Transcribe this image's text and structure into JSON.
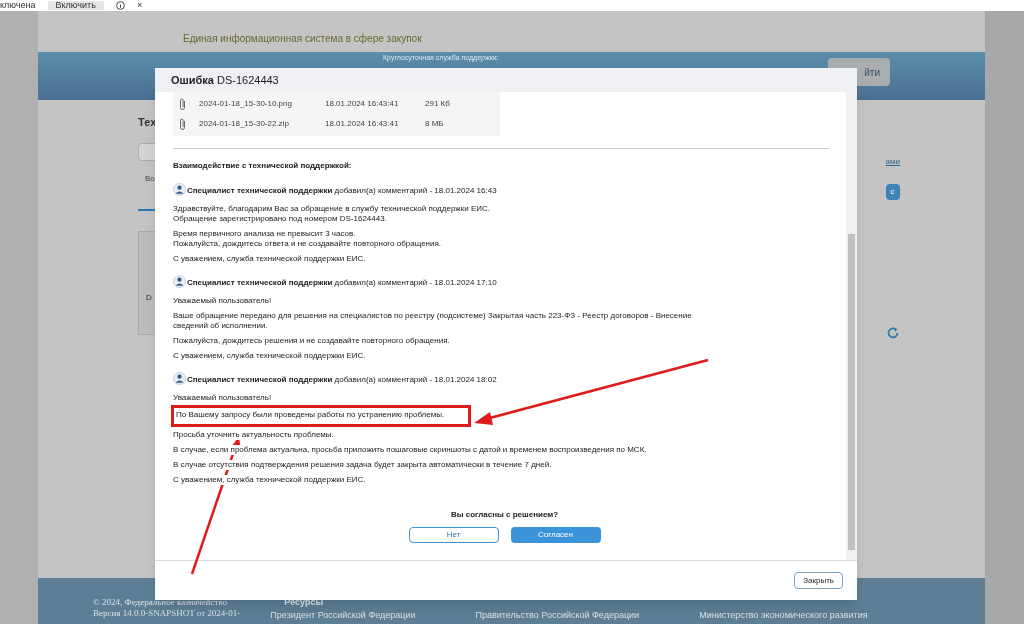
{
  "browser_bar": {
    "notice": "ключена",
    "button": "Включить",
    "close": "×"
  },
  "site": {
    "title": "Единая информационная система в сфере закупок",
    "support": "Круглосуточная служба поддержки:",
    "logout": "йти",
    "heading": "Тех",
    "field": "Во",
    "row_text": "D",
    "link": "ами",
    "action": "с"
  },
  "footer": {
    "copyright": "© 2024, Федеральное казначейство",
    "version": "Версия 14.0.0-SNAPSHOT от 2024-01-",
    "resources": "Ресурсы",
    "links": [
      "Президент Российской Федерации",
      "Правительство Российской Федерации",
      "Министерство экономического развития"
    ]
  },
  "modal": {
    "title": "**Ошибка** DS-1624443",
    "files": [
      {
        "name": "2024-01-18_15-30-10.png",
        "date": "18.01.2024 16:43:41",
        "size": "291 Кб"
      },
      {
        "name": "2024-01-18_15-30-22.zip",
        "date": "18.01.2024 16:43:41",
        "size": "8 МБ"
      }
    ],
    "section_heading": "Взаимодействие с технической поддержкой:",
    "comments": [
      {
        "header": "**Специалист технической поддержки** добавил(а) комментарий - 18.01.2024 16:43",
        "paragraphs": [
          {
            "text": "Здравствуйте, благодарим Вас за обращение в службу технической поддержки ЕИС.\nОбращение зарегистрировано под номером DS-1624443.",
            "highlighted": false
          },
          {
            "text": "Время первичного анализа не превысит 3 часов.\nПожалуйста, дождитесь ответа и не создавайте повторного обращения.",
            "highlighted": false
          },
          {
            "text": "С уважением, служба технической поддержки ЕИС.",
            "highlighted": false
          }
        ]
      },
      {
        "header": "**Специалист технической поддержки** добавил(а) комментарий - 18.01.2024 17:10",
        "paragraphs": [
          {
            "text": "Уважаемый пользователь!",
            "highlighted": false
          },
          {
            "text": "Ваше обращение передано для решения на специалистов по реестру (подсистеме) Закрытая часть 223-ФЗ - Реестр договоров - Внесение\nсведений об исполнении.",
            "highlighted": false
          },
          {
            "text": "Пожалуйста, дождитесь решения и не создавайте повторного обращения.",
            "highlighted": false
          },
          {
            "text": "С уважением, служба технической поддержки ЕИС.",
            "highlighted": false
          }
        ]
      },
      {
        "header": "**Специалист технической поддержки** добавил(а) комментарий - 18.01.2024 18:02",
        "paragraphs": [
          {
            "text": "Уважаемый пользователь!",
            "highlighted": false
          },
          {
            "text": "По Вашему запросу были проведены работы по устранению проблемы.",
            "highlighted": true
          },
          {
            "text": "Просьба уточнить актуальность проблемы.",
            "highlighted": false
          },
          {
            "text": "В случае, если проблема актуальна, просьба приложить пошаговые скриншоты с датой и временем воспроизведения по МСК.",
            "highlighted": false
          },
          {
            "text": "В случае отсутствия подтверждения решения задача будет закрыта автоматически в течение 7 дней.",
            "highlighted": false
          },
          {
            "text": "С уважением, служба технической поддержки ЕИС.",
            "highlighted": false
          }
        ]
      }
    ],
    "question": "Вы согласны с решением?",
    "answers": [
      {
        "label": "Нет",
        "kind": "secondary"
      },
      {
        "label": "Согласен",
        "kind": "primary"
      }
    ],
    "close": "Закрыть"
  }
}
